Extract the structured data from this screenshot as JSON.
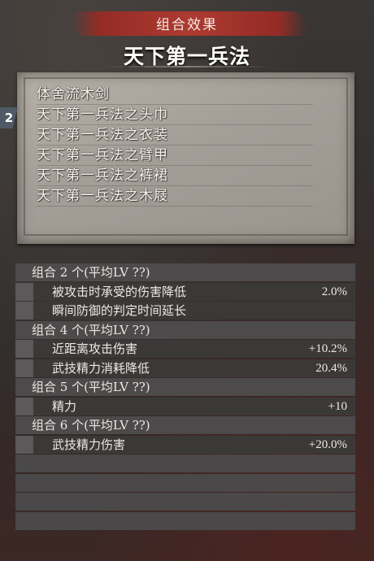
{
  "header": {
    "title": "组合效果"
  },
  "set_name": "天下第一兵法",
  "count_badge": "2",
  "equipment": [
    "体舍流木剑",
    "天下第一兵法之头巾",
    "天下第一兵法之衣装",
    "天下第一兵法之臂甲",
    "天下第一兵法之裤裙",
    "天下第一兵法之木屐"
  ],
  "groups": [
    {
      "label": "组合 2 个(平均LV  ??)",
      "effects": [
        {
          "label": "被攻击时承受的伤害降低",
          "value": "2.0%"
        },
        {
          "label": "瞬间防御的判定时间延长",
          "value": ""
        }
      ]
    },
    {
      "label": "组合 4 个(平均LV  ??)",
      "effects": [
        {
          "label": "近距离攻击伤害",
          "value": "+10.2%"
        },
        {
          "label": "武技精力消耗降低",
          "value": "20.4%"
        }
      ]
    },
    {
      "label": "组合 5 个(平均LV  ??)",
      "effects": [
        {
          "label": "精力",
          "value": "+10"
        }
      ]
    },
    {
      "label": "组合 6 个(平均LV  ??)",
      "effects": [
        {
          "label": "武技精力伤害",
          "value": "+20.0%"
        }
      ]
    }
  ],
  "colors": {
    "accent_red": "#b73a30",
    "row_group": "#4c4a4a",
    "row_effect": "#3a3938",
    "text": "#ede8e3"
  }
}
